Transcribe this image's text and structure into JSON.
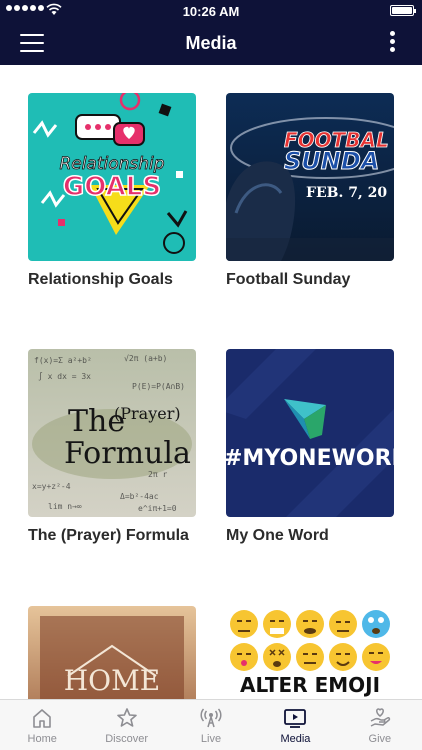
{
  "status_bar": {
    "time": "10:26 AM"
  },
  "nav": {
    "title": "Media"
  },
  "cards": [
    {
      "title": "Relationship Goals",
      "art_line1": "Relationship",
      "art_line2": "GOALS"
    },
    {
      "title": "Football Sunday",
      "art_line1": "FOOTBAL",
      "art_line2": "SUNDA",
      "art_line3": "FEB. 7, 20"
    },
    {
      "title": "The (Prayer) Formula",
      "art_line1": "The",
      "art_line2": "(Prayer)",
      "art_line3": "Formula"
    },
    {
      "title": "My One Word",
      "art_line1": "#MYONEWORD"
    },
    {
      "title": "",
      "art_line1": "HOME"
    },
    {
      "title": "",
      "art_line1": "ALTER EMOJI"
    }
  ],
  "tabs": [
    {
      "label": "Home",
      "icon": "home-icon"
    },
    {
      "label": "Discover",
      "icon": "star-icon"
    },
    {
      "label": "Live",
      "icon": "broadcast-icon"
    },
    {
      "label": "Media",
      "icon": "media-icon"
    },
    {
      "label": "Give",
      "icon": "give-icon"
    }
  ],
  "colors": {
    "nav_background": "#0e1238",
    "tab_active": "#0e1238",
    "tab_inactive": "#8e8e93"
  }
}
